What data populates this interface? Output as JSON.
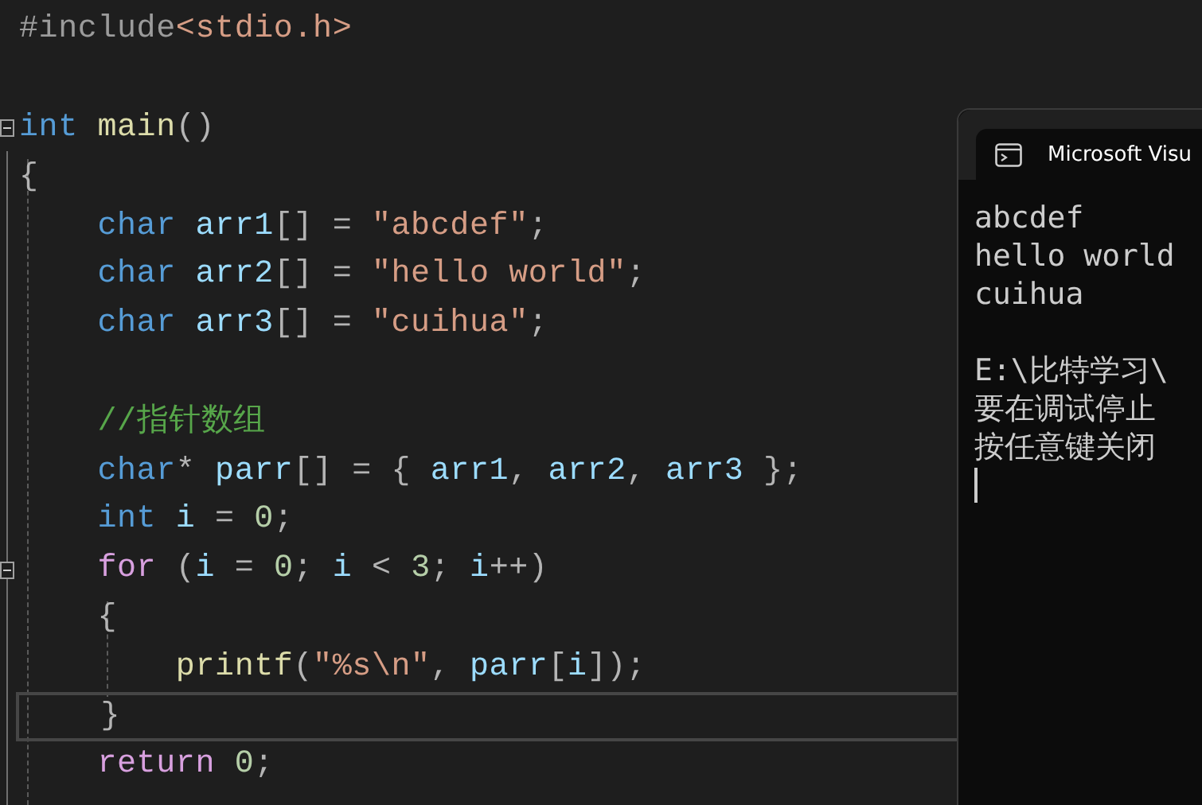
{
  "editor": {
    "lines": [
      {
        "current": false,
        "tokens": [
          {
            "text": "#include",
            "kind": "preproc"
          },
          {
            "text": "<stdio.h>",
            "kind": "string"
          }
        ]
      },
      {
        "current": false
      },
      {
        "current": false,
        "folded": false,
        "tokens": [
          {
            "text": "int",
            "kind": "keyword"
          },
          {
            "text": " main",
            "kind": "func"
          },
          {
            "text": "()",
            "kind": "punct"
          }
        ]
      },
      {
        "current": false,
        "tokens": [
          {
            "text": "{",
            "kind": "punct"
          }
        ]
      },
      {
        "current": false,
        "tokens": [
          {
            "text": "    char",
            "kind": "keyword"
          },
          {
            "text": " arr1",
            "kind": "ident"
          },
          {
            "text": "[] = ",
            "kind": "punct"
          },
          {
            "text": "\"abcdef\"",
            "kind": "string"
          },
          {
            "text": ";",
            "kind": "punct"
          }
        ]
      },
      {
        "current": false,
        "tokens": [
          {
            "text": "    char",
            "kind": "keyword"
          },
          {
            "text": " arr2",
            "kind": "ident"
          },
          {
            "text": "[] = ",
            "kind": "punct"
          },
          {
            "text": "\"hello world\"",
            "kind": "string"
          },
          {
            "text": ";",
            "kind": "punct"
          }
        ]
      },
      {
        "current": false,
        "tokens": [
          {
            "text": "    char",
            "kind": "keyword"
          },
          {
            "text": " arr3",
            "kind": "ident"
          },
          {
            "text": "[] = ",
            "kind": "punct"
          },
          {
            "text": "\"cuihua\"",
            "kind": "string"
          },
          {
            "text": ";",
            "kind": "punct"
          }
        ]
      },
      {
        "current": false
      },
      {
        "current": false,
        "tokens": [
          {
            "text": "    //指针数组",
            "kind": "comment"
          }
        ]
      },
      {
        "current": false,
        "tokens": [
          {
            "text": "    char",
            "kind": "keyword"
          },
          {
            "text": "* ",
            "kind": "punct"
          },
          {
            "text": "parr",
            "kind": "ident"
          },
          {
            "text": "[] = { ",
            "kind": "punct"
          },
          {
            "text": "arr1",
            "kind": "ident"
          },
          {
            "text": ", ",
            "kind": "punct"
          },
          {
            "text": "arr2",
            "kind": "ident"
          },
          {
            "text": ", ",
            "kind": "punct"
          },
          {
            "text": "arr3",
            "kind": "ident"
          },
          {
            "text": " };",
            "kind": "punct"
          }
        ]
      },
      {
        "current": false,
        "tokens": [
          {
            "text": "    int",
            "kind": "keyword"
          },
          {
            "text": " i",
            "kind": "ident"
          },
          {
            "text": " = ",
            "kind": "punct"
          },
          {
            "text": "0",
            "kind": "number"
          },
          {
            "text": ";",
            "kind": "punct"
          }
        ]
      },
      {
        "current": false,
        "folded": false,
        "tokens": [
          {
            "text": "    for",
            "kind": "control"
          },
          {
            "text": " (",
            "kind": "punct"
          },
          {
            "text": "i",
            "kind": "ident"
          },
          {
            "text": " = ",
            "kind": "punct"
          },
          {
            "text": "0",
            "kind": "number"
          },
          {
            "text": "; ",
            "kind": "punct"
          },
          {
            "text": "i",
            "kind": "ident"
          },
          {
            "text": " < ",
            "kind": "punct"
          },
          {
            "text": "3",
            "kind": "number"
          },
          {
            "text": "; ",
            "kind": "punct"
          },
          {
            "text": "i",
            "kind": "ident"
          },
          {
            "text": "++)",
            "kind": "punct"
          }
        ]
      },
      {
        "current": false,
        "tokens": [
          {
            "text": "    {",
            "kind": "punct"
          }
        ]
      },
      {
        "current": false,
        "tokens": [
          {
            "text": "        printf",
            "kind": "func"
          },
          {
            "text": "(",
            "kind": "punct"
          },
          {
            "text": "\"%s\\n\"",
            "kind": "string"
          },
          {
            "text": ", ",
            "kind": "punct"
          },
          {
            "text": "parr",
            "kind": "ident"
          },
          {
            "text": "[",
            "kind": "punct"
          },
          {
            "text": "i",
            "kind": "ident"
          },
          {
            "text": "]);",
            "kind": "punct"
          }
        ]
      },
      {
        "current": true,
        "tokens": [
          {
            "text": "    }",
            "kind": "punct"
          }
        ]
      },
      {
        "current": false,
        "tokens": [
          {
            "text": "    return",
            "kind": "control"
          },
          {
            "text": " 0",
            "kind": "number"
          },
          {
            "text": ";",
            "kind": "punct"
          }
        ]
      }
    ]
  },
  "console": {
    "tab_title": "Microsoft Visu",
    "output": [
      "abcdef",
      "hello world",
      "cuihua"
    ],
    "messages": [
      "E:\\比特学习\\",
      "要在调试停止",
      "按任意键关闭"
    ]
  }
}
